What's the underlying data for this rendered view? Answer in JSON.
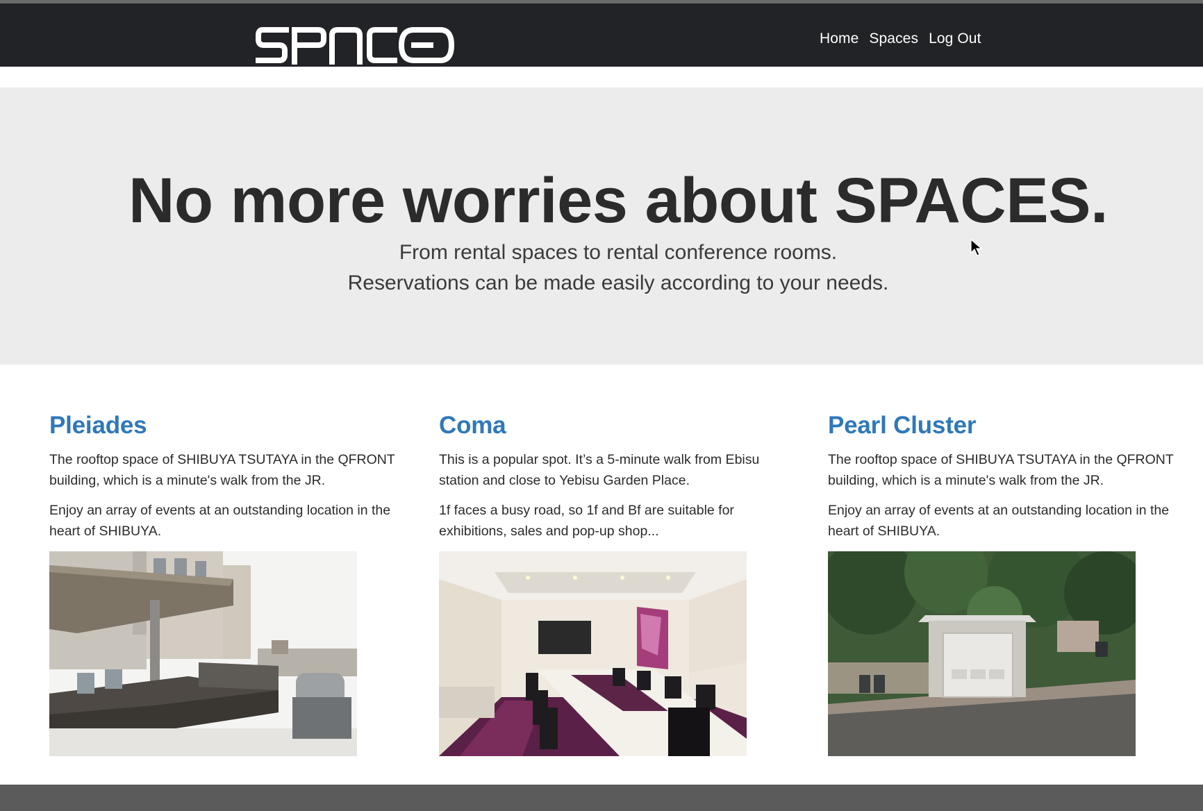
{
  "nav": {
    "logo_text": "SPACES",
    "links": [
      {
        "label": "Home"
      },
      {
        "label": "Spaces"
      },
      {
        "label": "Log Out"
      }
    ]
  },
  "hero": {
    "title": "No more worries about SPACES.",
    "subtitle_line1": "From rental spaces to rental conference rooms.",
    "subtitle_line2": "Reservations can be made easily according to your needs."
  },
  "spaces": [
    {
      "name": "Pleiades",
      "paragraphs": [
        "The rooftop space of SHIBUYA TSUTAYA in the QFRONT building, which is a minute's walk from the JR.",
        "Enjoy an array of events at an outstanding location in the heart of SHIBUYA."
      ],
      "photo_icon": "rooftop-kitchen-photo"
    },
    {
      "name": "Coma",
      "paragraphs": [
        "This is a popular spot. It’s a 5-minute walk from Ebisu station and close to Yebisu Garden Place.",
        "1f faces a busy road, so 1f and Bf are suitable for exhibitions, sales and pop-up shop..."
      ],
      "photo_icon": "conference-room-photo"
    },
    {
      "name": "Pearl Cluster",
      "paragraphs": [
        "The rooftop space of SHIBUYA TSUTAYA in the QFRONT building, which is a minute's walk from the JR.",
        "Enjoy an array of events at an outstanding location in the heart of SHIBUYA."
      ],
      "photo_icon": "garage-photo"
    }
  ],
  "colors": {
    "navbar": "#222326",
    "hero_bg": "#ececec",
    "link_blue": "#2f78b9"
  }
}
